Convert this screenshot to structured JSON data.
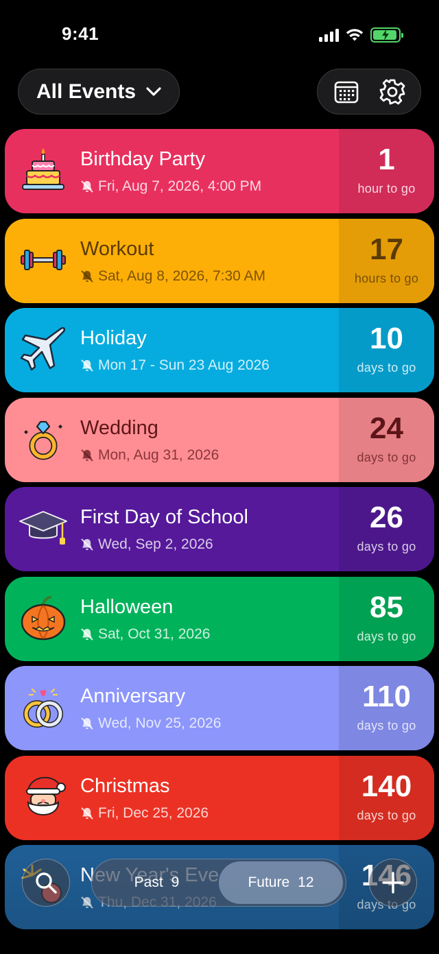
{
  "status_bar": {
    "time": "9:41",
    "battery_color": "#52d66a"
  },
  "header": {
    "filter_label": "All Events",
    "calendar_icon": "calendar-icon",
    "settings_icon": "gear-icon"
  },
  "events": [
    {
      "title": "Birthday Party",
      "date": "Fri, Aug 7, 2026, 4:00 PM",
      "count": "1",
      "unit": "hour to go",
      "icon": "cake-icon",
      "bg": "#e8305f",
      "box": "#d12b57",
      "fg": "#ffffff",
      "sub": "rgba(255,255,255,0.82)"
    },
    {
      "title": "Workout",
      "date": "Sat, Aug 8, 2026, 7:30 AM",
      "count": "17",
      "unit": "hours to go",
      "icon": "dumbbell-icon",
      "bg": "#fdaf07",
      "box": "#e49d06",
      "fg": "#5a3a05",
      "sub": "rgba(90,58,5,0.78)"
    },
    {
      "title": "Holiday",
      "date": "Mon 17 - Sun 23 Aug 2026",
      "count": "10",
      "unit": "days to go",
      "icon": "airplane-icon",
      "bg": "#06acdf",
      "box": "#059bc9",
      "fg": "#ffffff",
      "sub": "rgba(255,255,255,0.82)"
    },
    {
      "title": "Wedding",
      "date": "Mon, Aug 31, 2026",
      "count": "24",
      "unit": "days to go",
      "icon": "ring-icon",
      "bg": "#ff8e94",
      "box": "#e58086",
      "fg": "#5c1518",
      "sub": "rgba(92,21,24,0.72)"
    },
    {
      "title": "First Day of School",
      "date": "Wed, Sep 2, 2026",
      "count": "26",
      "unit": "days to go",
      "icon": "graduation-cap-icon",
      "bg": "#55199a",
      "box": "#4c178b",
      "fg": "#ffffff",
      "sub": "rgba(255,255,255,0.78)"
    },
    {
      "title": "Halloween",
      "date": "Sat, Oct 31, 2026",
      "count": "85",
      "unit": "days to go",
      "icon": "pumpkin-icon",
      "bg": "#00b35b",
      "box": "#00a152",
      "fg": "#ffffff",
      "sub": "rgba(255,255,255,0.82)"
    },
    {
      "title": "Anniversary",
      "date": "Wed, Nov 25, 2026",
      "count": "110",
      "unit": "days to go",
      "icon": "rings-icon",
      "bg": "#8c96fb",
      "box": "#7e87e2",
      "fg": "#ffffff",
      "sub": "rgba(255,255,255,0.78)"
    },
    {
      "title": "Christmas",
      "date": "Fri, Dec 25, 2026",
      "count": "140",
      "unit": "days to go",
      "icon": "santa-icon",
      "bg": "#eb3124",
      "box": "#d42c20",
      "fg": "#ffffff",
      "sub": "rgba(255,255,255,0.8)"
    },
    {
      "title": "New Year's Eve",
      "date": "Thu, Dec 31, 2026",
      "count": "146",
      "unit": "days to go",
      "icon": "fireworks-icon",
      "bg": "#1f5e95",
      "box": "#1b5486",
      "fg": "#ffffff",
      "sub": "rgba(255,255,255,0.7)"
    }
  ],
  "bottom_bar": {
    "search_icon": "search-icon",
    "past_label": "Past",
    "past_count": "9",
    "future_label": "Future",
    "future_count": "12",
    "add_icon": "plus-icon"
  }
}
